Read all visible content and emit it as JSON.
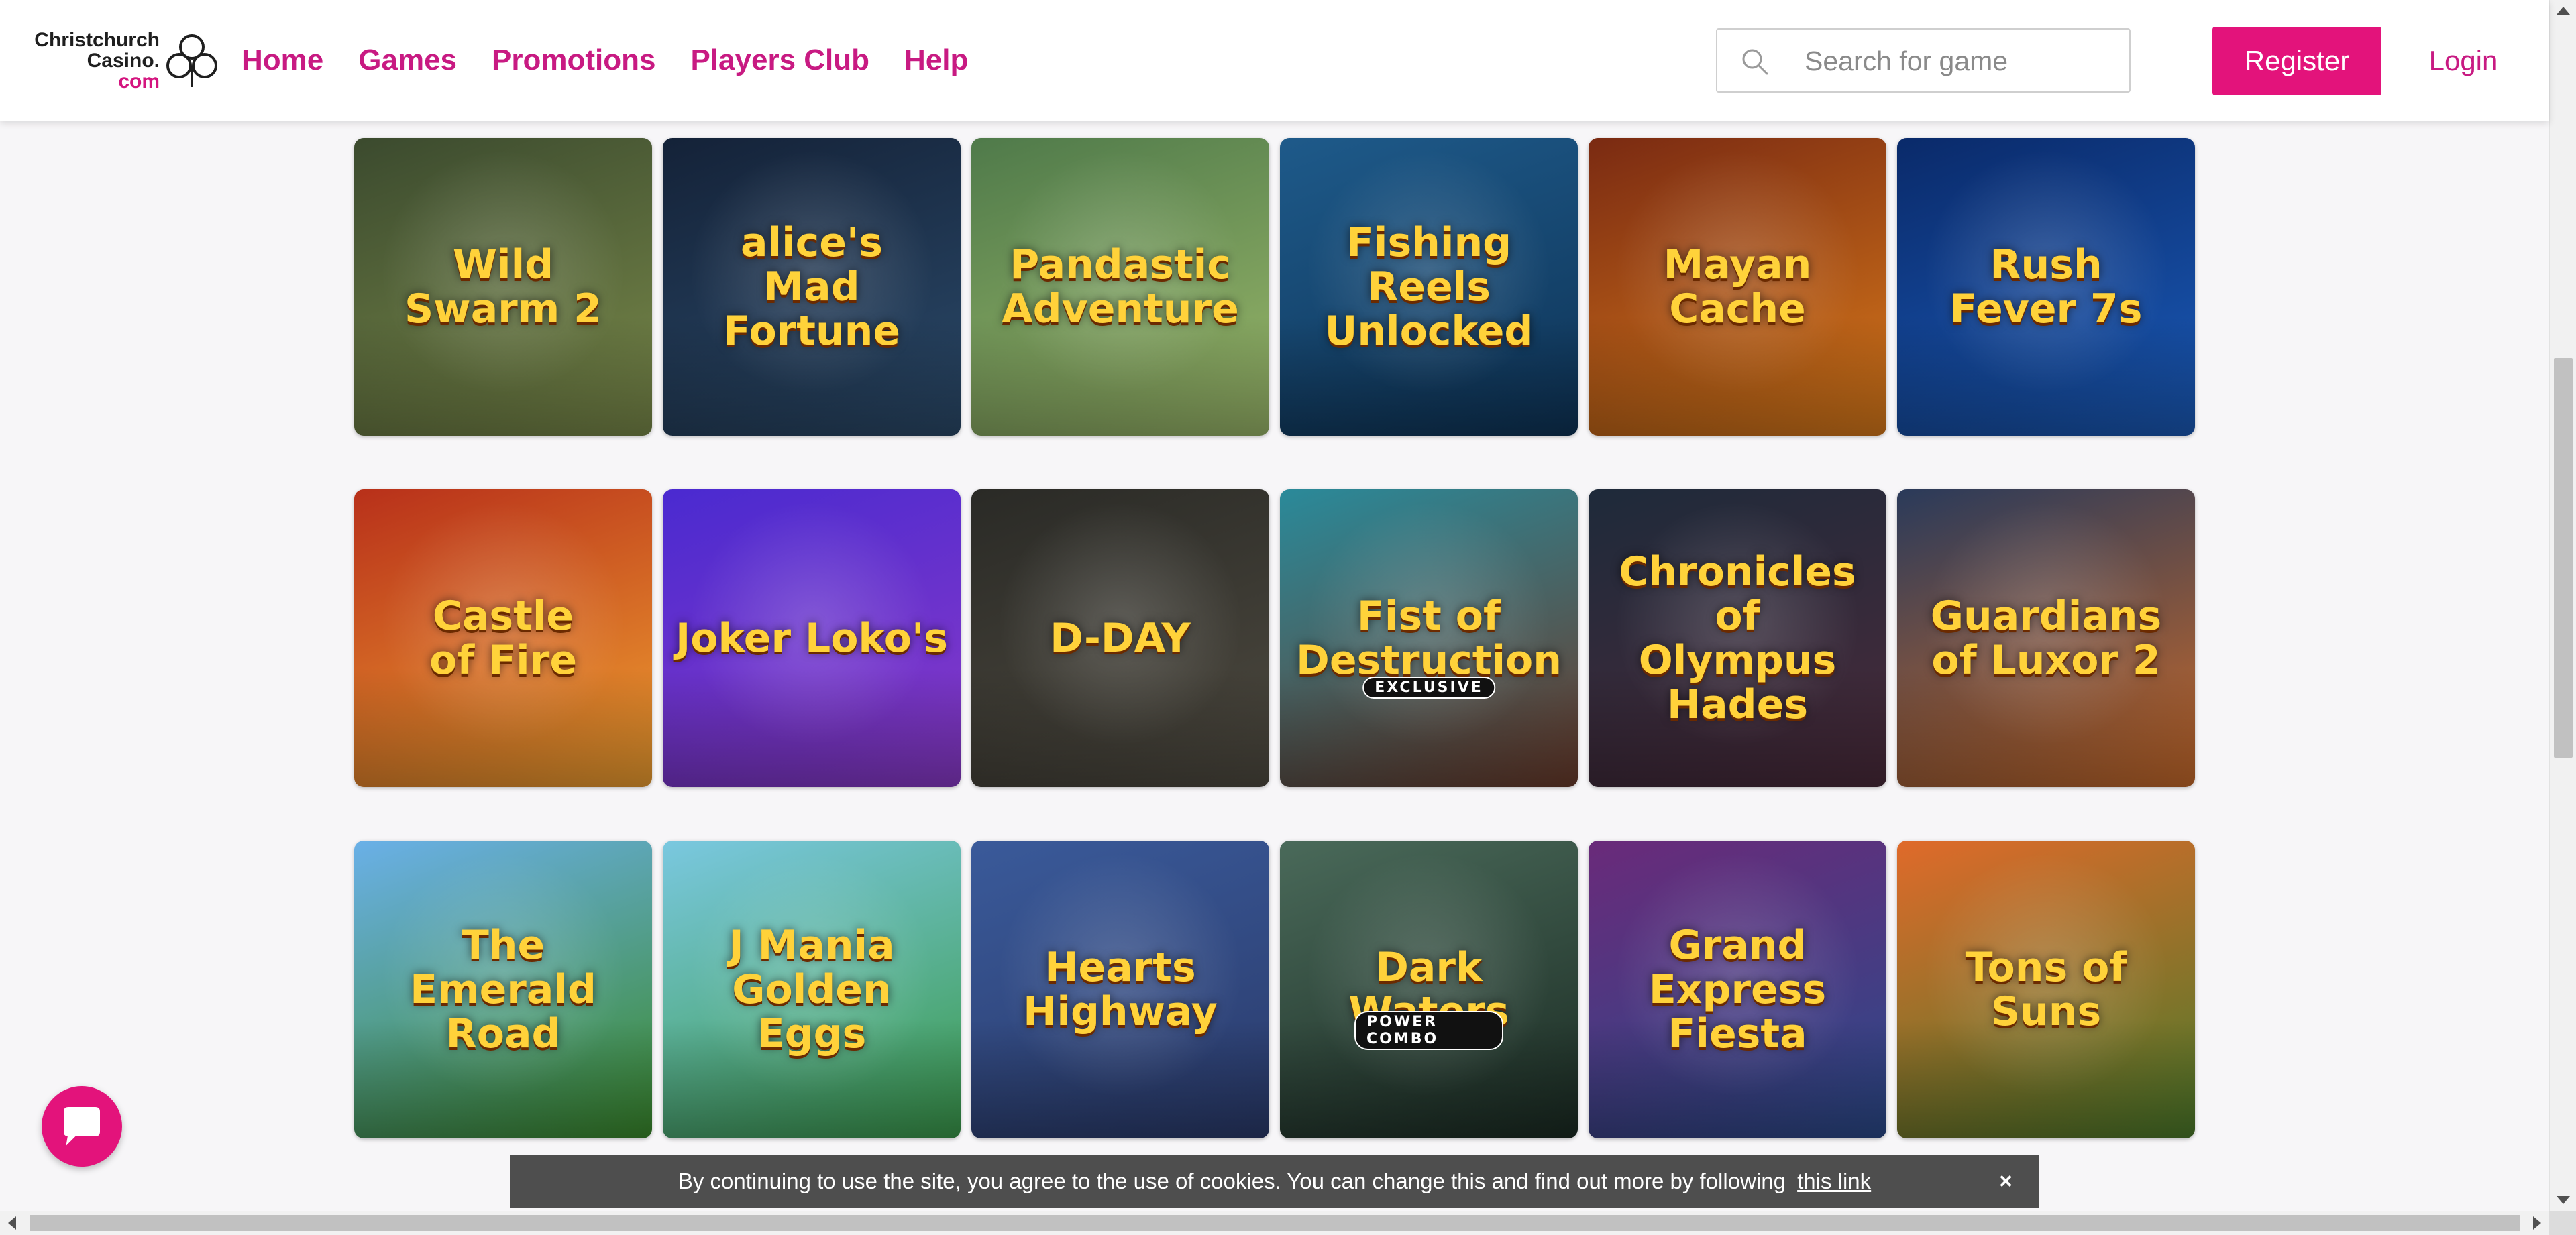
{
  "header": {
    "logo": {
      "line1": "Christchurch",
      "line2": "Casino.",
      "line3": "com"
    },
    "nav": [
      "Home",
      "Games",
      "Promotions",
      "Players Club",
      "Help"
    ],
    "search": {
      "placeholder": "Search for game",
      "value": ""
    },
    "register_label": "Register",
    "login_label": "Login"
  },
  "games": [
    {
      "name": "Wild\nSwarm 2"
    },
    {
      "name": "alice's\nMad Fortune"
    },
    {
      "name": "Pandastic\nAdventure"
    },
    {
      "name": "Fishing Reels\nUnlocked"
    },
    {
      "name": "Mayan\nCache"
    },
    {
      "name": "Rush\nFever 7s"
    },
    {
      "name": "Castle\nof Fire"
    },
    {
      "name": "Joker Loko's"
    },
    {
      "name": "D-DAY"
    },
    {
      "name": "Fist of\nDestruction",
      "tag": "EXCLUSIVE"
    },
    {
      "name": "Chronicles of\nOlympus\nHades"
    },
    {
      "name": "Guardians\nof Luxor 2"
    },
    {
      "name": "The\nEmerald\nRoad"
    },
    {
      "name": "J Mania\nGolden Eggs"
    },
    {
      "name": "Hearts\nHighway"
    },
    {
      "name": "Dark\nWaters",
      "tag": "POWER COMBO"
    },
    {
      "name": "Grand Express\nFiesta"
    },
    {
      "name": "Tons of\nSuns"
    }
  ],
  "tile_colors": [
    [
      "#3b4a2e",
      "#7a8a4a"
    ],
    [
      "#142238",
      "#2b4a6a"
    ],
    [
      "#4f7a4a",
      "#9bb86a"
    ],
    [
      "#1e5a8a",
      "#0e3356"
    ],
    [
      "#7a2a12",
      "#d97a1a"
    ],
    [
      "#0a2a6a",
      "#1a5ab8"
    ],
    [
      "#b8301a",
      "#f0a030"
    ],
    [
      "#4a2ad0",
      "#8a3ac8"
    ],
    [
      "#2a2a26",
      "#4e4a40"
    ],
    [
      "#2a8a9a",
      "#6a3a2a"
    ],
    [
      "#1e2a3a",
      "#4a2a3a"
    ],
    [
      "#2a3a5a",
      "#c86a2a"
    ],
    [
      "#6ab0e8",
      "#3a8a2a"
    ],
    [
      "#7ac8e0",
      "#3a9a4a"
    ],
    [
      "#3a5a9a",
      "#2a3a6a"
    ],
    [
      "#4a6a5a",
      "#1a2a22"
    ],
    [
      "#6a2a7a",
      "#2a4a8a"
    ],
    [
      "#e06a2a",
      "#4a7a2a"
    ]
  ],
  "cookie": {
    "text": "By continuing to use the site, you agree to the use of cookies. You can change this and find out more by following",
    "link": "this link",
    "close": "×"
  },
  "icons": {
    "search": "search-icon",
    "chat": "chat-icon",
    "logo": "clover-icon"
  }
}
